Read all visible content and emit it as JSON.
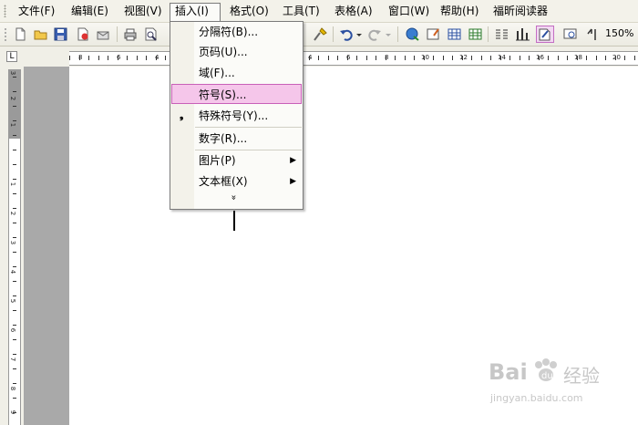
{
  "menubar": {
    "items": [
      "文件(F)",
      "编辑(E)",
      "视图(V)",
      "插入(I)",
      "格式(O)",
      "工具(T)",
      "表格(A)",
      "窗口(W)",
      "帮助(H)",
      "福昕阅读器"
    ]
  },
  "toolbar": {
    "zoom": "150%"
  },
  "ruler": {
    "corner": "L",
    "h_labels": [
      "8",
      "6",
      "4",
      "4",
      "6",
      "8",
      "10",
      "12",
      "14",
      "16",
      "18",
      "20"
    ],
    "v_labels": [
      "3",
      "2",
      "1",
      "1",
      "2",
      "3",
      "4",
      "5",
      "6",
      "7",
      "8",
      "9"
    ]
  },
  "insert_menu": {
    "items": [
      {
        "label": "分隔符(B)..."
      },
      {
        "label": "页码(U)..."
      },
      {
        "label": "域(F)..."
      },
      {
        "label": "符号(S)..."
      },
      {
        "label": "特殊符号(Y)..."
      },
      {
        "label": "数字(R)..."
      },
      {
        "label": "图片(P)"
      },
      {
        "label": "文本框(X)"
      }
    ],
    "more": "»"
  },
  "watermark": {
    "brand": "Bai",
    "brand2": "经验",
    "url": "jingyan.baidu.com"
  }
}
